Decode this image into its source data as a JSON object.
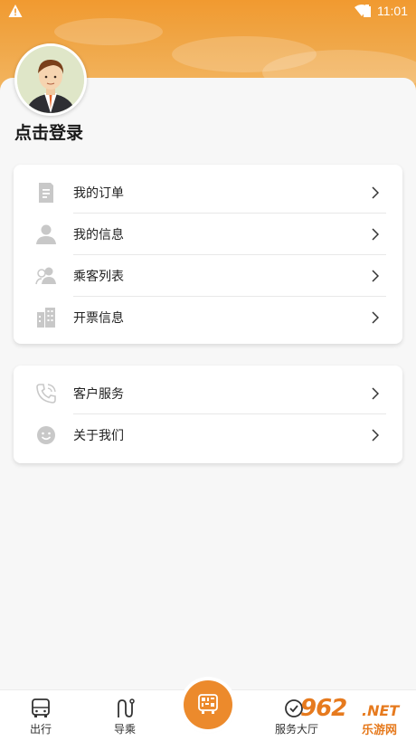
{
  "status_bar": {
    "time": "11:01"
  },
  "profile": {
    "login_text": "点击登录"
  },
  "menu_group_1": [
    {
      "label": "我的订单",
      "icon": "document-icon"
    },
    {
      "label": "我的信息",
      "icon": "person-icon"
    },
    {
      "label": "乘客列表",
      "icon": "passengers-icon"
    },
    {
      "label": "开票信息",
      "icon": "building-icon"
    }
  ],
  "menu_group_2": [
    {
      "label": "客户服务",
      "icon": "phone-icon"
    },
    {
      "label": "关于我们",
      "icon": "smiley-icon"
    }
  ],
  "bottom_nav": {
    "items": [
      {
        "label": "出行",
        "icon": "bus-icon"
      },
      {
        "label": "导乘",
        "icon": "route-icon"
      },
      {
        "label": "服务大厅",
        "icon": "service-hall-icon"
      }
    ],
    "center_icon": "bus-qrcode-icon"
  },
  "watermark": {
    "brand": "962",
    "suffix": ".NET",
    "site": "乐游网"
  },
  "colors": {
    "accent": "#ec8a2c",
    "header": "#f19a30",
    "icon_gray": "#c8c8c8"
  }
}
